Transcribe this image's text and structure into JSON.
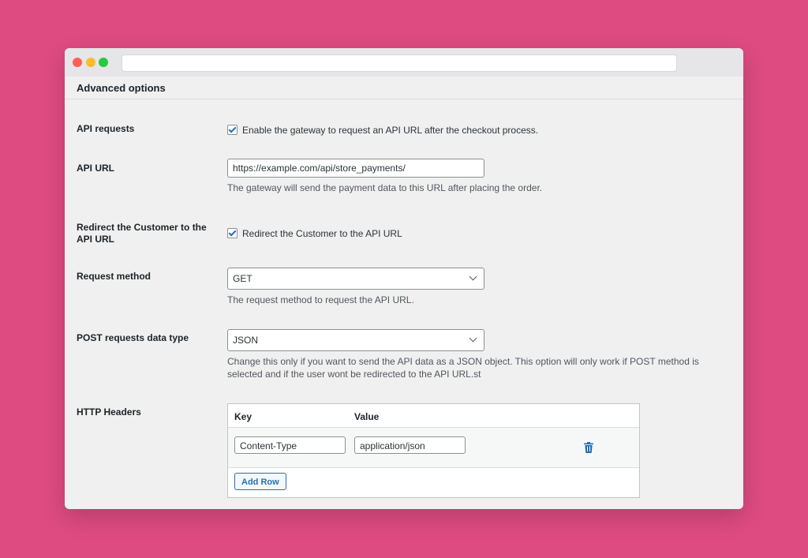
{
  "section": {
    "title": "Advanced options"
  },
  "api_requests": {
    "label": "API requests",
    "checkbox_label": "Enable the gateway to request an API URL after the checkout process.",
    "checked": true
  },
  "api_url": {
    "label": "API URL",
    "value": "https://example.com/api/store_payments/",
    "description": "The gateway will send the payment data to this URL after placing the order."
  },
  "redirect": {
    "label": "Redirect the Customer to the API URL",
    "checkbox_label": "Redirect the Customer to the API URL",
    "checked": true
  },
  "request_method": {
    "label": "Request method",
    "value": "GET",
    "description": "The request method to request the API URL."
  },
  "post_data_type": {
    "label": "POST requests data type",
    "value": "JSON",
    "description": "Change this only if you want to send the API data as a JSON object. This option will only work if POST method is selected and if the user wont be redirected to the API URL.st"
  },
  "http_headers": {
    "label": "HTTP Headers",
    "columns": [
      "Key",
      "Value"
    ],
    "rows": [
      {
        "key": "Content-Type",
        "value": "application/json"
      }
    ],
    "add_row_label": "Add Row"
  },
  "icons": {
    "delete": "trash-icon",
    "dropdown": "chevron-down-icon",
    "check": "checkmark-icon"
  },
  "colors": {
    "background": "#de4b81",
    "accent": "#2271b1",
    "window": "#f0f0f1"
  }
}
